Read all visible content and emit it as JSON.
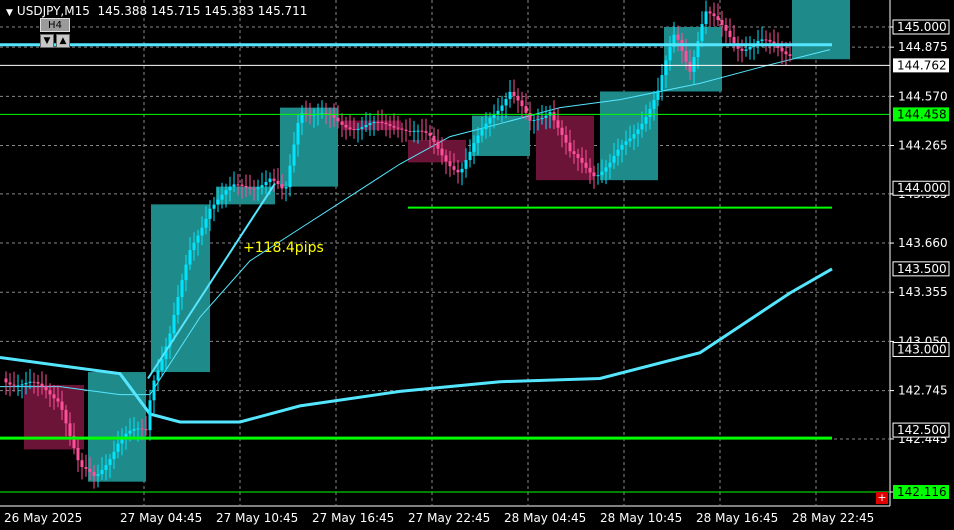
{
  "header": {
    "symbol": "USDJPY,M15",
    "ohlc": "145.388 145.715 145.383 145.711"
  },
  "timeframe": {
    "label": "H4",
    "down_glyph": "▼",
    "up_glyph": "▲"
  },
  "corner_button": "+",
  "chart_data": {
    "type": "candlestick",
    "y_axis": {
      "ticks": [
        "145.000",
        "144.875",
        "144.570",
        "144.265",
        "143.965",
        "143.660",
        "143.355",
        "143.050",
        "142.745",
        "142.445",
        "142.116"
      ]
    },
    "x_axis": {
      "ticks": [
        "26 May 2025",
        "27 May 04:45",
        "27 May 10:45",
        "27 May 16:45",
        "27 May 22:45",
        "28 May 04:45",
        "28 May 10:45",
        "28 May 16:45",
        "28 May 22:45"
      ]
    },
    "price_labels": [
      {
        "text": "145.000",
        "price": 145.0,
        "style": "level"
      },
      {
        "text": "144.762",
        "price": 144.762,
        "style": "white"
      },
      {
        "text": "144.458",
        "price": 144.458,
        "style": "green"
      },
      {
        "text": "144.000",
        "price": 144.0,
        "style": "level"
      },
      {
        "text": "143.500",
        "price": 143.5,
        "style": "level"
      },
      {
        "text": "143.000",
        "price": 143.0,
        "style": "level"
      },
      {
        "text": "142.500",
        "price": 142.5,
        "style": "level"
      },
      {
        "text": "142.116",
        "price": 142.116,
        "style": "green"
      }
    ],
    "annotation": "+118.4pips",
    "colors": {
      "background": "#000000",
      "bull": "#00e5ff",
      "bear": "#ff4f9a",
      "bull_box": "#1f8a8a",
      "bear_box": "#6b1438",
      "ma": "#55e6ff",
      "level_line": "#00ff00",
      "annotation": "#ffff00"
    }
  }
}
